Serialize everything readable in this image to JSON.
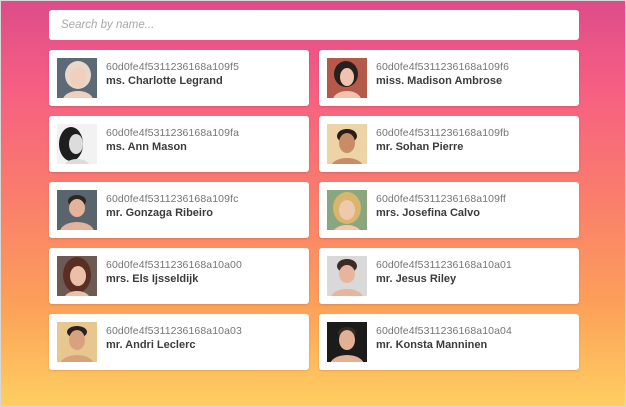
{
  "search": {
    "placeholder": "Search by name...",
    "value": ""
  },
  "users": [
    {
      "id": "60d0fe4f5311236168a109f5",
      "name": "ms. Charlotte Legrand",
      "avatar": {
        "bg": "#5c6a77",
        "skin": "#f1cfbf",
        "hair": "#e9d7c8"
      }
    },
    {
      "id": "60d0fe4f5311236168a109f6",
      "name": "miss. Madison Ambrose",
      "avatar": {
        "bg": "#b55a4a",
        "skin": "#efc3ae",
        "hair": "#27201d"
      }
    },
    {
      "id": "60d0fe4f5311236168a109fa",
      "name": "ms. Ann Mason",
      "avatar": {
        "bg": "#f2f2f2",
        "skin": "#dcdcdc",
        "hair": "#1e1e1e"
      }
    },
    {
      "id": "60d0fe4f5311236168a109fb",
      "name": "mr. Sohan Pierre",
      "avatar": {
        "bg": "#ecd4a6",
        "skin": "#c98c66",
        "hair": "#2a1d17"
      }
    },
    {
      "id": "60d0fe4f5311236168a109fc",
      "name": "mr. Gonzaga Ribeiro",
      "avatar": {
        "bg": "#59646c",
        "skin": "#e3b39b",
        "hair": "#2e2622"
      }
    },
    {
      "id": "60d0fe4f5311236168a109ff",
      "name": "mrs. Josefina Calvo",
      "avatar": {
        "bg": "#8aa67e",
        "skin": "#f0c9ad",
        "hair": "#d9b56e"
      }
    },
    {
      "id": "60d0fe4f5311236168a10a00",
      "name": "mrs. Els Ijsseldijk",
      "avatar": {
        "bg": "#6d5a52",
        "skin": "#ecc0a8",
        "hair": "#5a2e22"
      }
    },
    {
      "id": "60d0fe4f5311236168a10a01",
      "name": "mr. Jesus Riley",
      "avatar": {
        "bg": "#d9d9d9",
        "skin": "#e7b59e",
        "hair": "#3a2b24"
      }
    },
    {
      "id": "60d0fe4f5311236168a10a03",
      "name": "mr. Andri Leclerc",
      "avatar": {
        "bg": "#e8c690",
        "skin": "#d9a27f",
        "hair": "#2b211c"
      }
    },
    {
      "id": "60d0fe4f5311236168a10a04",
      "name": "mr. Konsta Manninen",
      "avatar": {
        "bg": "#1b1b1b",
        "skin": "#e2b095",
        "hair": "#3a2a20"
      }
    }
  ]
}
